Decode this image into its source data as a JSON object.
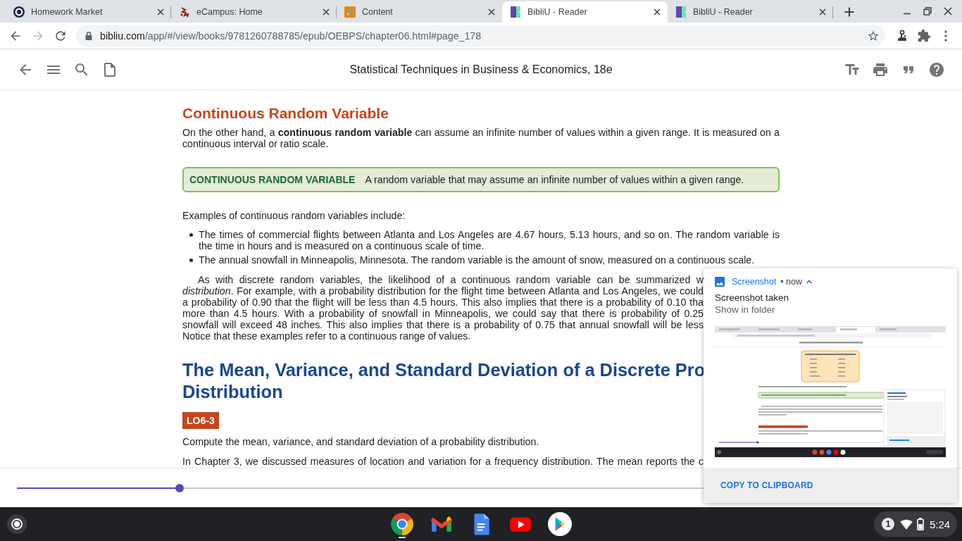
{
  "browser": {
    "tabs": [
      {
        "title": "Homework Market",
        "kind": "homework",
        "selected": false
      },
      {
        "title": "eCampus: Home",
        "kind": "ecampus",
        "selected": false
      },
      {
        "title": "Content",
        "kind": "content",
        "selected": false
      },
      {
        "title": "BibliU - Reader",
        "kind": "bibliu",
        "selected": true
      },
      {
        "title": "BibliU - Reader",
        "kind": "bibliu",
        "selected": false
      }
    ],
    "forward_disabled": true,
    "url": {
      "host": "bibliu.com",
      "path": "/app/#/view/books/9781260788785/epub/OEBPS/chapter06.html#page_178"
    }
  },
  "reader": {
    "title": "Statistical Techniques in Business & Economics, 18e"
  },
  "content": [
    {
      "kind": "heading",
      "text": "Continuous Random Variable"
    },
    {
      "kind": "paragraph",
      "text": "On the other hand, a **continuous random variable** can assume an infinite number of values within a given range. It is measured on a continuous interval or ratio scale."
    },
    {
      "kind": "definition",
      "term": "CONTINUOUS RANDOM VARIABLE",
      "text": "A random variable that may assume an infinite number of values within a given range."
    },
    {
      "kind": "paragraph",
      "text": "Examples of continuous random variables include:"
    },
    {
      "kind": "list",
      "items": [
        "The times of commercial flights between Atlanta and Los Angeles are 4.67 hours, 5.13 hours, and so on. The random variable is the time in hours and is measured on a continuous scale of time.",
        "The annual snowfall in Minneapolis, Minnesota. The random variable is the amount of snow, measured on a continuous scale."
      ]
    },
    {
      "kind": "lines",
      "indent": true,
      "lines": [
        {
          "text": "As with discrete random variables, the likelihood of a continuous random variable can be summarized w",
          "cut": true
        },
        {
          "text": "*distribution*. For example, with a probability distribution for the flight time between Atlanta and Los Angeles, we could",
          "cut": true
        },
        {
          "text": "a probability of 0.90 that the flight will be less than 4.5 hours. This also implies that there is a probability of 0.10 tha",
          "cut": true
        },
        {
          "text": "more than 4.5 hours. With a probability of snowfall in Minneapolis, we could say that there is probability of 0.25",
          "cut": true
        },
        {
          "text": "snowfall will exceed 48 inches. This also implies that there is a probability of 0.75 that annual snowfall will be less",
          "cut": true
        },
        {
          "text": "Notice that these examples refer to a continuous range of values.",
          "cut": false
        }
      ]
    },
    {
      "kind": "section_heading",
      "lines": [
        "The Mean, Variance, and Standard Deviation of a Discrete Pro",
        "Distribution"
      ]
    },
    {
      "kind": "badge",
      "text": "LO6-3"
    },
    {
      "kind": "paragraph",
      "text": "Compute the mean, variance, and standard deviation of a probability distribution."
    },
    {
      "kind": "lines",
      "indent": false,
      "lines": [
        {
          "text": "In Chapter 3, we discussed measures of location and variation for a frequency distribution. The mean reports the c",
          "cut": true
        }
      ]
    }
  ],
  "progress": {
    "level": 0.175
  },
  "notification": {
    "app": "Screenshot",
    "time": "• now",
    "expanded": true,
    "title": "Screenshot taken",
    "subtitle": "Show in folder",
    "action": "COPY TO CLIPBOARD"
  },
  "shelf": {
    "apps": [
      {
        "kind": "chrome",
        "running": true
      },
      {
        "kind": "gmail",
        "running": false
      },
      {
        "kind": "docs",
        "running": false
      },
      {
        "kind": "youtube",
        "running": false
      },
      {
        "kind": "play",
        "running": false
      }
    ],
    "notification_count": "1",
    "time": "5:24"
  }
}
